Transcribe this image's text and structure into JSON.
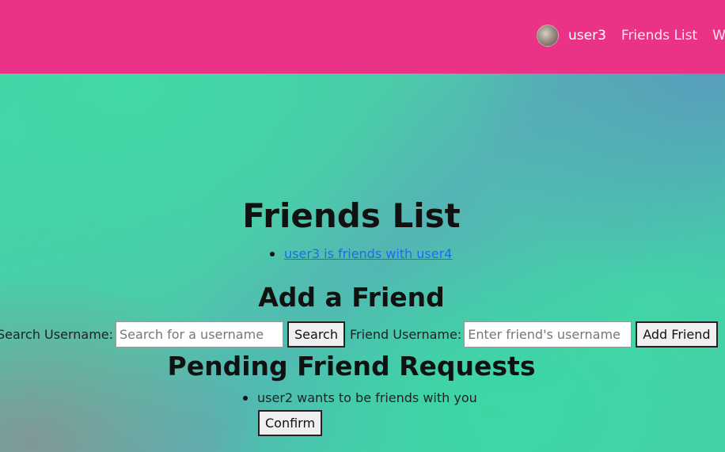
{
  "nav": {
    "user_label": "user3",
    "links": [
      "Friends List",
      "Wis"
    ]
  },
  "friends": {
    "title": "Friends List",
    "items": [
      "user3 is friends with user4"
    ]
  },
  "add_friend": {
    "title": "Add a Friend",
    "search_label": "Search Username:",
    "search_placeholder": "Search for a username",
    "search_button": "Search",
    "friend_label": "Friend Username:",
    "friend_placeholder": "Enter friend's username",
    "add_button": "Add Friend"
  },
  "pending": {
    "title": "Pending Friend Requests",
    "requests": [
      {
        "text": "user2 wants to be friends with you",
        "confirm_label": "Confirm"
      }
    ]
  }
}
